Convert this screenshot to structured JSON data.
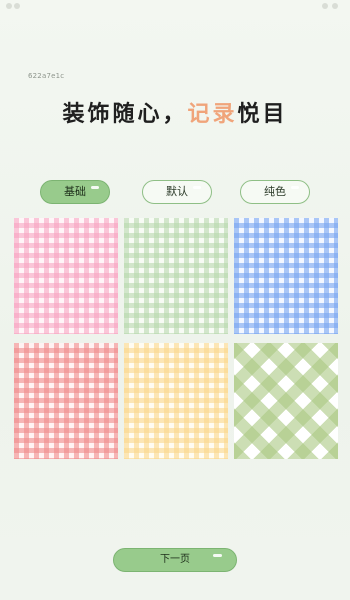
{
  "page_id": "622a7e1c",
  "headline": {
    "part1": "装饰随心，",
    "accent": "记录",
    "part2": "悦目"
  },
  "tabs": [
    {
      "label": "基础",
      "active": true
    },
    {
      "label": "默认",
      "active": false
    },
    {
      "label": "纯色",
      "active": false
    }
  ],
  "patterns": [
    {
      "name": "pink-gingham",
      "color": "#f7a0be"
    },
    {
      "name": "green-gingham",
      "color": "#b4d6aa"
    },
    {
      "name": "blue-gingham",
      "color": "#78a5f0"
    },
    {
      "name": "red-gingham",
      "color": "#f08c8c"
    },
    {
      "name": "yellow-gingham",
      "color": "#fad78c"
    },
    {
      "name": "green-diagonal-gingham",
      "color": "#aac882"
    }
  ],
  "next_button": {
    "label": "下一页"
  },
  "colors": {
    "accent_green": "#98cb8c",
    "headline_accent": "#f0a47a"
  }
}
